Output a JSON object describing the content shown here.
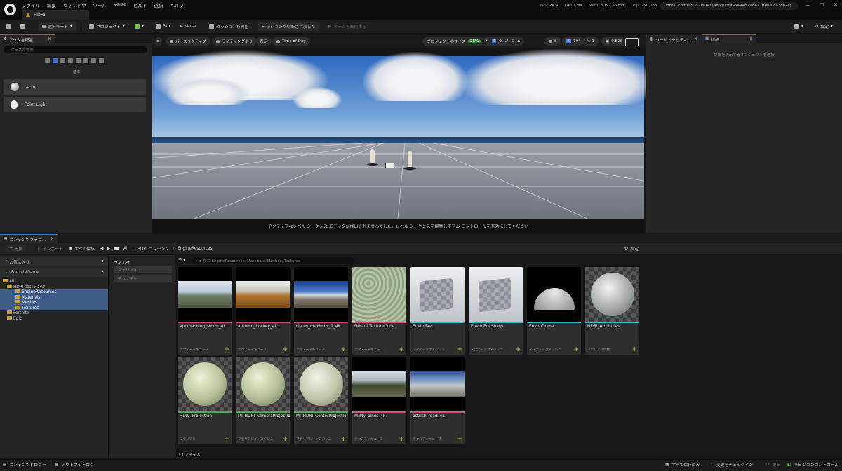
{
  "app": {
    "menu": [
      "ファイル",
      "編集",
      "ウィンドウ",
      "ツール",
      "Verse",
      "ビルド",
      "選択",
      "ヘルプ"
    ],
    "tab_title": "HDRI",
    "stats": {
      "fps_label": "FPS:",
      "fps": "24.9",
      "ms": "/ 40.1 ms",
      "mem_label": "Mem:",
      "mem": "3,197.56 mb",
      "objs_label": "Objs:",
      "objs": "290,033"
    },
    "project_title": "Unreal Editor 5.2 - HDRI (ae5303fa96444d298411ddf00ca3cd7c)"
  },
  "toolbar": {
    "mode": "選択モード",
    "project": "プロジェクト",
    "fab": "Fab",
    "verse": "Verse",
    "session": "セッションを開始",
    "disconnected": "ッションが切断されました",
    "start_game": "ゲームを開始する",
    "settings": "設定"
  },
  "place_actors": {
    "tab": "アクタを配置",
    "search_placeholder": "クラスの検索",
    "category": "基本",
    "items": [
      "Actor",
      "Point Light"
    ]
  },
  "viewport": {
    "perspective": "パースペクティブ",
    "lighting": "ライティングあり",
    "show": "表示",
    "time_of_day": "Time of Day",
    "project_size": "プロジェクトのサイズ",
    "project_size_pct": "28%",
    "grid": "8",
    "angle": "10°",
    "scale": "1",
    "cam_speed": "0.528",
    "message": "アクティブなレベル シーケンス エディタが検出されませんでした。レベル シーケンスを編集してフル コントロールを有効にしてください"
  },
  "right_panel": {
    "tab_world": "ワールドセッティ...",
    "tab_details": "詳細",
    "empty_text": "詳細を表示するオブジェクトを選択"
  },
  "content_browser": {
    "tab": "コンテンツブラウ...",
    "add": "追加",
    "import": "インポート",
    "save_all": "すべて保存",
    "path": [
      "All",
      "HDRI コンテンツ",
      "EngineResources"
    ],
    "settings": "設定",
    "favorites": "お気に入り",
    "root": "FortniteGame",
    "tree": [
      "All",
      "HDRI コンテンツ",
      "EngineResources",
      "Materials",
      "Meshes",
      "Textures",
      "Fortnite",
      "Epic"
    ],
    "filter_header": "フィルタ",
    "filters": [
      "マテリアル",
      "テクスチャ"
    ],
    "search_placeholder": "検索 EngineResources, Materials, Meshes, Textures",
    "item_count": "13 アイテム",
    "assets": [
      {
        "name": "approaching_storm_4k",
        "type": "テクスチャキューブ",
        "color": "#d0567a"
      },
      {
        "name": "autumn_hockey_4k",
        "type": "テクスチャキューブ",
        "color": "#d0567a"
      },
      {
        "name": "circus_maximus_2_4k",
        "type": "テクスチャキューブ",
        "color": "#d0567a"
      },
      {
        "name": "DefaultTextureCube",
        "type": "テクスチャキューブ",
        "color": "#d0567a"
      },
      {
        "name": "EnviroBox",
        "type": "スタティックメッシュ",
        "color": "#3fb8d8"
      },
      {
        "name": "EnviroBoxSharp",
        "type": "スタティックメッシュ",
        "color": "#3fb8d8"
      },
      {
        "name": "EnviroDome",
        "type": "スタティックメッシュ",
        "color": "#3fb8d8"
      },
      {
        "name": "HDRI_Attributes",
        "type": "マテリアル関数",
        "color": "#3fb8d8"
      },
      {
        "name": "HDRI_Projection",
        "type": "マテリアル",
        "color": "#4cae4c"
      },
      {
        "name": "MI_HDRI_CameraProjection",
        "type": "マテリアルインスタンス",
        "color": "#4cae4c"
      },
      {
        "name": "MI_HDRI_CenterProjection",
        "type": "マテリアルインスタンス",
        "color": "#4cae4c"
      },
      {
        "name": "misty_pines_4k",
        "type": "テクスチャキューブ",
        "color": "#d0567a"
      },
      {
        "name": "ostrich_road_4k",
        "type": "テクスチャキューブ",
        "color": "#d0567a"
      }
    ]
  },
  "statusbar": {
    "content_drawer": "コンテンツドロワー",
    "output_log": "アウトプットログ",
    "save_all": "すべて保存済み",
    "check_in": "変更をチェックイン",
    "update": "更新",
    "revision": "リビジョンコントロール"
  }
}
